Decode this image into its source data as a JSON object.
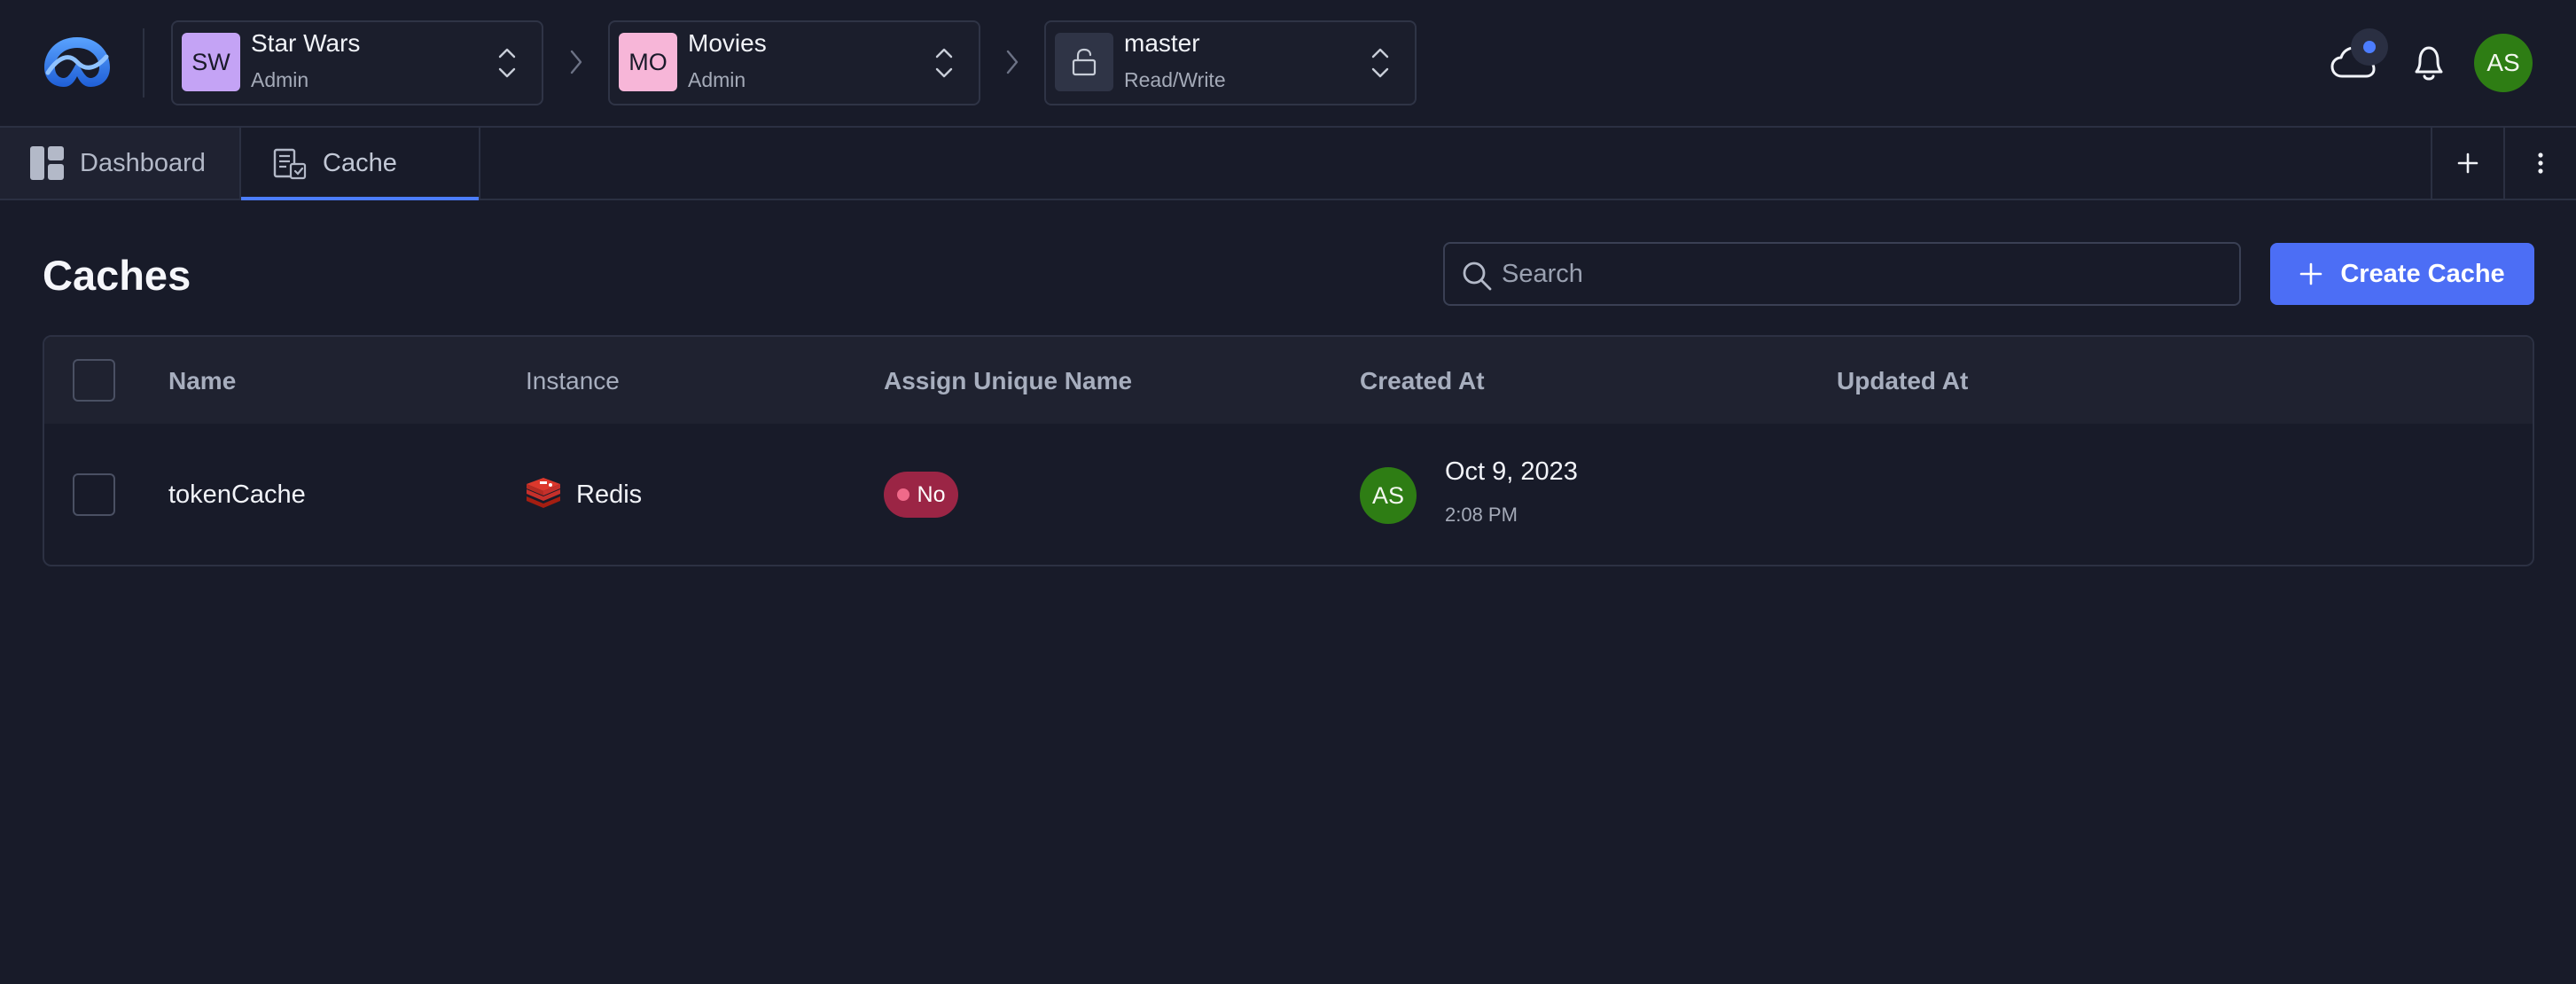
{
  "header": {
    "org": {
      "initials": "SW",
      "name": "Star Wars",
      "role": "Admin",
      "color": "#c4a3f5"
    },
    "project": {
      "initials": "MO",
      "name": "Movies",
      "role": "Admin",
      "color": "#f7b6d8"
    },
    "environment": {
      "name": "master",
      "access": "Read/Write"
    },
    "user_initials": "AS"
  },
  "tabs": [
    {
      "label": "Dashboard",
      "icon": "dashboard-icon"
    },
    {
      "label": "Cache",
      "icon": "cache-icon",
      "active": true
    }
  ],
  "page": {
    "title": "Caches",
    "search_placeholder": "Search",
    "create_label": "Create Cache"
  },
  "table": {
    "columns": [
      "Name",
      "Instance",
      "Assign Unique Name",
      "Created At",
      "Updated At"
    ],
    "rows": [
      {
        "name": "tokenCache",
        "instance": "Redis",
        "assign_unique_name": "No",
        "created_by_initials": "AS",
        "created_date": "Oct 9, 2023",
        "created_time": "2:08 PM",
        "updated_at": ""
      }
    ]
  },
  "colors": {
    "accent": "#4c6ef5",
    "background": "#181b29",
    "badge_no": "#9b2545",
    "avatar_green": "#2e7d14"
  }
}
